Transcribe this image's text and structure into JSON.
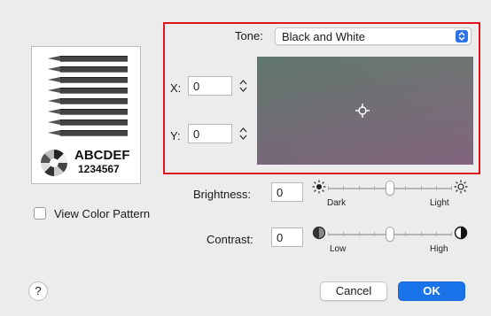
{
  "preview": {
    "text_line1": "ABCDEF",
    "text_line2": "1234567"
  },
  "tone": {
    "label": "Tone:",
    "selected": "Black and White",
    "x_label": "X:",
    "x_value": "0",
    "y_label": "Y:",
    "y_value": "0"
  },
  "brightness": {
    "label": "Brightness:",
    "value": "0",
    "min_label": "Dark",
    "max_label": "Light",
    "level": 0.5
  },
  "contrast": {
    "label": "Contrast:",
    "value": "0",
    "min_label": "Low",
    "max_label": "High",
    "level": 0.5
  },
  "view_color_pattern": {
    "label": "View Color Pattern",
    "checked": false
  },
  "buttons": {
    "help": "?",
    "cancel": "Cancel",
    "ok": "OK"
  },
  "colors": {
    "highlight_box": "#e0141e",
    "accent": "#1a73e8"
  }
}
